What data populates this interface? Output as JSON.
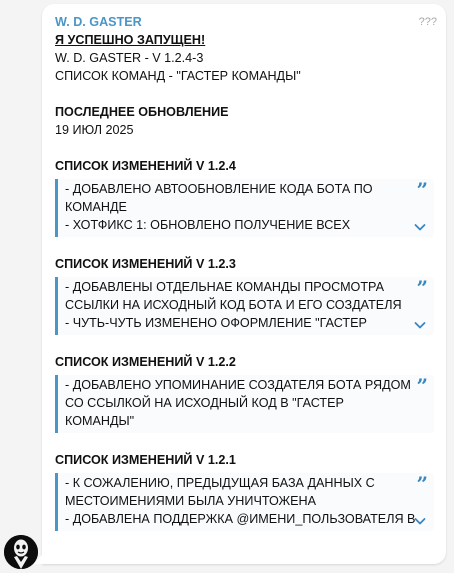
{
  "message": {
    "sender": "W. D. GASTER",
    "views": "???",
    "header_line1": "Я УСПЕШНО ЗАПУЩЕН!",
    "header_line2": "W. D. GASTER - V 1.2.4-3",
    "header_line3": "СПИСОК КОМАНД - \"ГАСТЕР КОМАНДЫ\"",
    "last_update_title": "ПОСЛЕДНЕЕ ОБНОВЛЕНИЕ",
    "last_update_date": "19 ИЮЛ 2025"
  },
  "changelogs": [
    {
      "title": "СПИСОК ИЗМЕНЕНИЙ V 1.2.4",
      "lines": [
        "- ДОБАВЛЕНО АВТООБНОВЛЕНИЕ КОДА БОТА ПО",
        "КОМАНДЕ",
        "- ХОТФИКС 1: ОБНОВЛЕНО ПОЛУЧЕНИЕ ВСЕХ"
      ],
      "expandable": true
    },
    {
      "title": "СПИСОК ИЗМЕНЕНИЙ V 1.2.3",
      "lines": [
        "- ДОБАВЛЕНЫ ОТДЕЛЬНАЕ КОМАНДЫ ПРОСМОТРА",
        "ССЫЛКИ НА ИСХОДНЫЙ КОД БОТА И ЕГО СОЗДАТЕЛЯ",
        "- ЧУТЬ-ЧУТЬ ИЗМЕНЕНО ОФОРМЛЕНИЕ \"ГАСТЕР"
      ],
      "expandable": true
    },
    {
      "title": "СПИСОК ИЗМЕНЕНИЙ V 1.2.2",
      "lines": [
        "- ДОБАВЛЕНО УПОМИНАНИЕ СОЗДАТЕЛЯ БОТА РЯДОМ",
        "СО ССЫЛКОЙ НА ИСХОДНЫЙ КОД В \"ГАСТЕР",
        "КОМАНДЫ\""
      ],
      "expandable": false
    },
    {
      "title": "СПИСОК ИЗМЕНЕНИЙ V 1.2.1",
      "lines": [
        "- К СОЖАЛЕНИЮ, ПРЕДЫДУЩАЯ БАЗА ДАННЫХ С",
        "МЕСТОИМЕНИЯМИ БЫЛА УНИЧТОЖЕНА",
        "- ДОБАВЛЕНА ПОДДЕРЖКА @ИМЕНИ_ПОЛЬЗОВАТЕЛЯ В"
      ],
      "expandable": true
    }
  ],
  "colors": {
    "accent": "#4a96c7",
    "quote_icon": "#3a87c0",
    "views": "#a8a8a8"
  },
  "icons": {
    "quote": "quote-icon",
    "expand": "chevron-down-icon",
    "avatar": "gaster-avatar"
  }
}
